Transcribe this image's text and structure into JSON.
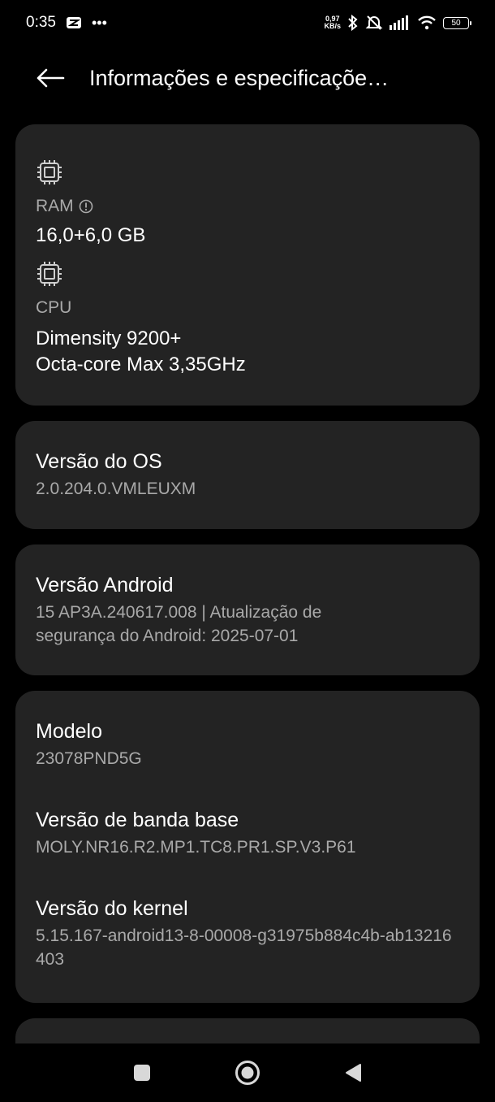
{
  "status": {
    "time": "0:35",
    "net_speed_value": "0,97",
    "net_speed_unit": "KB/s",
    "battery": "50"
  },
  "header": {
    "title": "Informações e especificaçõe…"
  },
  "specs": {
    "ram_label": "RAM",
    "ram_value": "16,0+6,0 GB",
    "cpu_label": "CPU",
    "cpu_line1": "Dimensity 9200+",
    "cpu_line2": "Octa-core Max 3,35GHz"
  },
  "os": {
    "title": "Versão do OS",
    "value": "2.0.204.0.VMLEUXM"
  },
  "android": {
    "title": "Versão Android",
    "value": "15 AP3A.240617.008 | Atualização de segurança do Android: 2025-07-01"
  },
  "device": {
    "model_title": "Modelo",
    "model_value": "23078PND5G",
    "baseband_title": "Versão de banda base",
    "baseband_value": "MOLY.NR16.R2.MP1.TC8.PR1.SP.V3.P61",
    "kernel_title": "Versão do kernel",
    "kernel_value": "5.15.167-android13-8-00008-g31975b884c4b-ab13216403"
  }
}
